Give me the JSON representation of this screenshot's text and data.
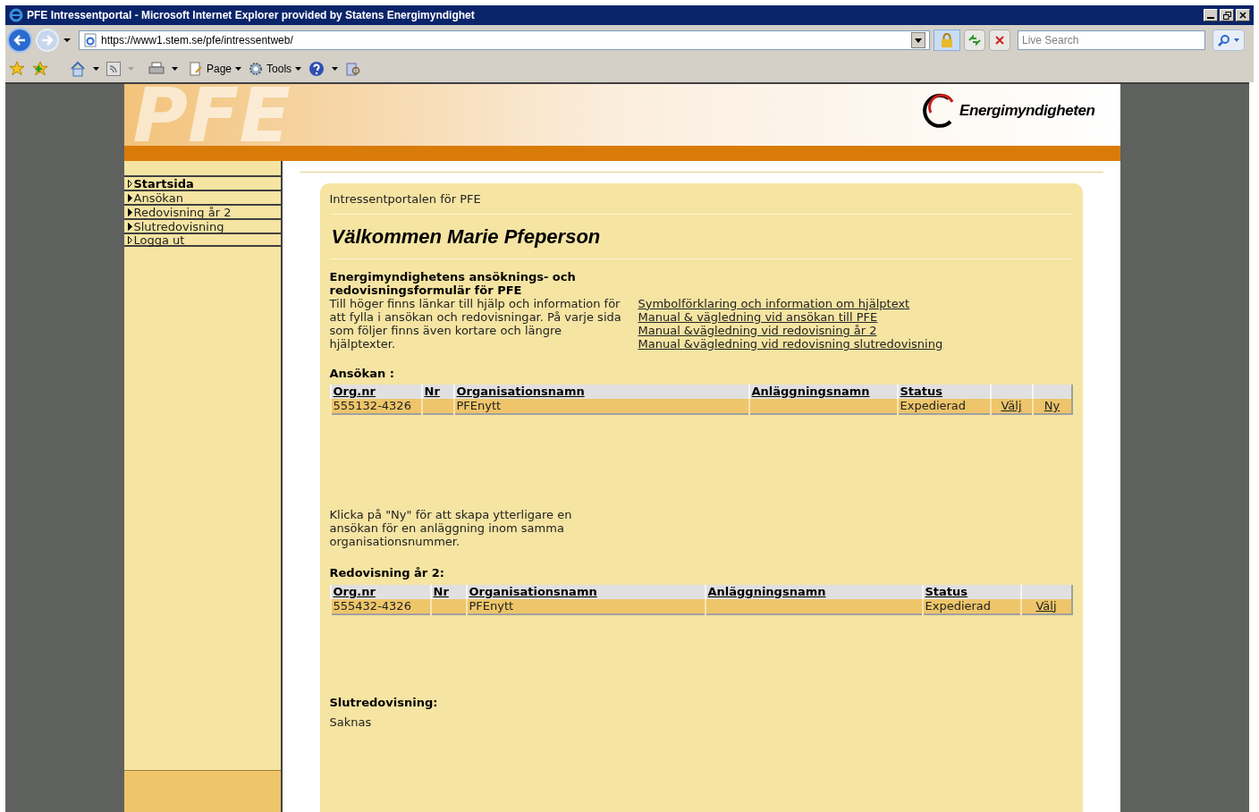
{
  "window": {
    "title": "PFE Intressentportal - Microsoft Internet Explorer provided by Statens Energimyndighet"
  },
  "address_bar": {
    "url": "https://www1.stem.se/pfe/intressentweb/"
  },
  "search": {
    "placeholder": "Live Search"
  },
  "toolbar": [
    {
      "kind": "page",
      "label": "Page"
    },
    {
      "kind": "tools",
      "label": "Tools"
    }
  ],
  "header": {
    "logo_text": "PFE",
    "brand": "Energimyndigheten"
  },
  "sidebar": {
    "items": [
      {
        "label": "Startsida",
        "selected": true,
        "has_submenu": false
      },
      {
        "label": "Ansökan",
        "selected": false,
        "has_submenu": true
      },
      {
        "label": "Redovisning år 2",
        "selected": false,
        "has_submenu": true
      },
      {
        "label": "Slutredovisning",
        "selected": false,
        "has_submenu": true
      },
      {
        "label": "Logga ut",
        "selected": false,
        "has_submenu": false
      }
    ]
  },
  "content": {
    "breadcrumb": "Intressentportalen för PFE",
    "heading": "Välkommen Marie Pfeperson",
    "intro_title": "Energimyndighetens ansöknings- och redovisningsformulär för PFE",
    "intro_text": "Till höger finns länkar till hjälp och information för att fylla i ansökan och redovisningar. På varje sida som följer finns även kortare och längre hjälptexter.",
    "help_links": [
      "Symbolförklaring och information om hjälptext",
      "Manual & vägledning vid ansökan till PFE",
      "Manual &vägledning vid redovisning år 2",
      "Manual &vägledning vid redovisning slutredovisning"
    ],
    "sections": [
      {
        "title": "Ansökan :",
        "table": {
          "columns": [
            "Org.nr",
            "Nr",
            "Organisationsnamn",
            "Anläggningsnamn",
            "Status",
            "",
            ""
          ],
          "rows": [
            {
              "cells": [
                "555132-4326",
                "",
                "PFEnytt",
                "",
                "Expedierad"
              ],
              "links": [
                "Välj",
                "Ny"
              ]
            }
          ]
        },
        "note": "Klicka på \"Ny\" för att skapa ytterligare en ansökan för en anläggning inom samma organisationsnummer."
      },
      {
        "title": "Redovisning år 2:",
        "table": {
          "columns": [
            "Org.nr",
            "Nr",
            "Organisationsnamn",
            "Anläggningsnamn",
            "Status",
            ""
          ],
          "rows": [
            {
              "cells": [
                "555432-4326",
                "",
                "PFEnytt",
                "",
                "Expedierad"
              ],
              "links": [
                "Välj"
              ]
            }
          ]
        }
      },
      {
        "title": "Slutredovisning:",
        "text": "Saknas"
      }
    ]
  }
}
